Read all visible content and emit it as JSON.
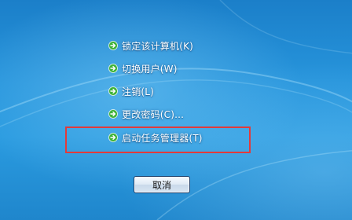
{
  "menu": {
    "items": [
      {
        "label": "锁定该计算机(K)",
        "icon": "green-arrow-icon"
      },
      {
        "label": "切换用户(W)",
        "icon": "green-arrow-icon"
      },
      {
        "label": "注销(L)",
        "icon": "green-arrow-icon"
      },
      {
        "label": "更改密码(C)...",
        "icon": "green-arrow-icon"
      },
      {
        "label": "启动任务管理器(T)",
        "icon": "green-arrow-icon"
      }
    ]
  },
  "cancel_button": {
    "label": "取消"
  },
  "colors": {
    "background": "#2795dc",
    "highlight_border": "#e33a3a",
    "arrow_green": "#3fb33a"
  }
}
